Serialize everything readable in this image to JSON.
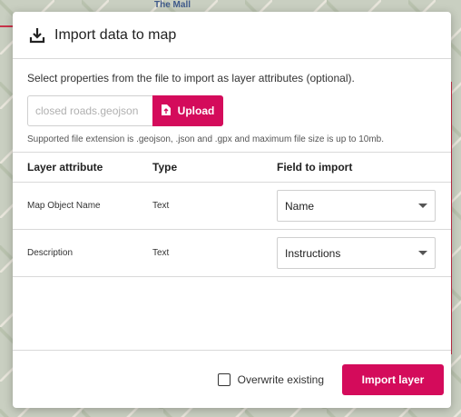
{
  "map": {
    "street_label": "The Mall"
  },
  "modal": {
    "title": "Import data to map",
    "title_icon": "download-icon",
    "intro": "Select properties from the file to import as layer attributes (optional).",
    "file_input": {
      "placeholder": "closed roads.geojson",
      "value": ""
    },
    "upload_button": {
      "label": "Upload",
      "icon": "file-icon"
    },
    "hint": "Supported file extension is .geojson, .json and .gpx and maximum file size is up to 10mb.",
    "table": {
      "headers": [
        "Layer attribute",
        "Type",
        "Field to import"
      ],
      "rows": [
        {
          "attribute": "Map Object Name",
          "type": "Text",
          "field": "Name"
        },
        {
          "attribute": "Description",
          "type": "Text",
          "field": "Instructions"
        }
      ]
    },
    "footer": {
      "overwrite_label": "Overwrite existing",
      "overwrite_checked": false,
      "import_button": "Import layer"
    }
  },
  "colors": {
    "accent": "#d40b5b",
    "border": "#d9d9d9"
  }
}
